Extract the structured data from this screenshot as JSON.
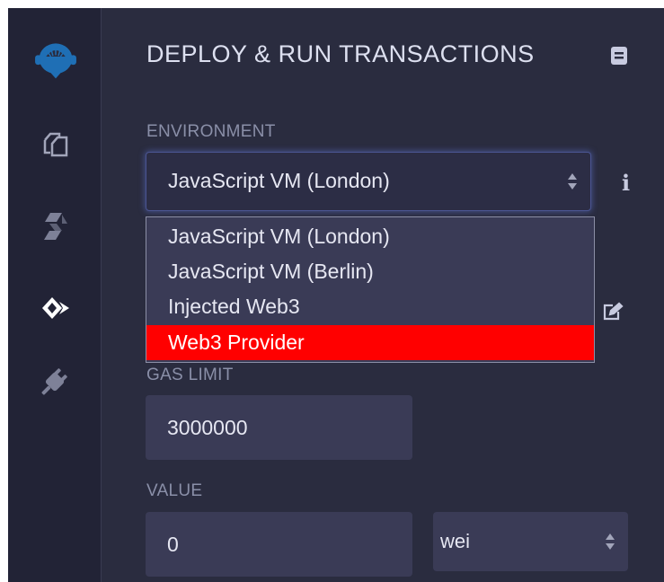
{
  "sidebar": {
    "icons": [
      {
        "name": "remix-logo-icon"
      },
      {
        "name": "file-explorer-icon"
      },
      {
        "name": "solidity-compiler-icon"
      },
      {
        "name": "deploy-run-icon",
        "active": true
      },
      {
        "name": "plugin-manager-icon"
      }
    ]
  },
  "panel": {
    "title": "DEPLOY & RUN TRANSACTIONS",
    "environment": {
      "label": "ENVIRONMENT",
      "selected": "JavaScript VM (London)",
      "options": [
        {
          "label": "JavaScript VM (London)",
          "selected": false
        },
        {
          "label": "JavaScript VM (Berlin)",
          "selected": false
        },
        {
          "label": "Injected Web3",
          "selected": false
        },
        {
          "label": "Web3 Provider",
          "selected": true
        }
      ]
    },
    "info_glyph": "i",
    "gas_limit": {
      "label": "GAS LIMIT",
      "value": "3000000"
    },
    "value": {
      "label": "VALUE",
      "amount": "0",
      "unit": "wei"
    }
  },
  "colors": {
    "panel_bg": "#2a2c3f",
    "iconbar_bg": "#222336",
    "accent_blue": "#1f6fb5",
    "highlight": "#ff0000",
    "input_bg": "#3a3b56"
  }
}
